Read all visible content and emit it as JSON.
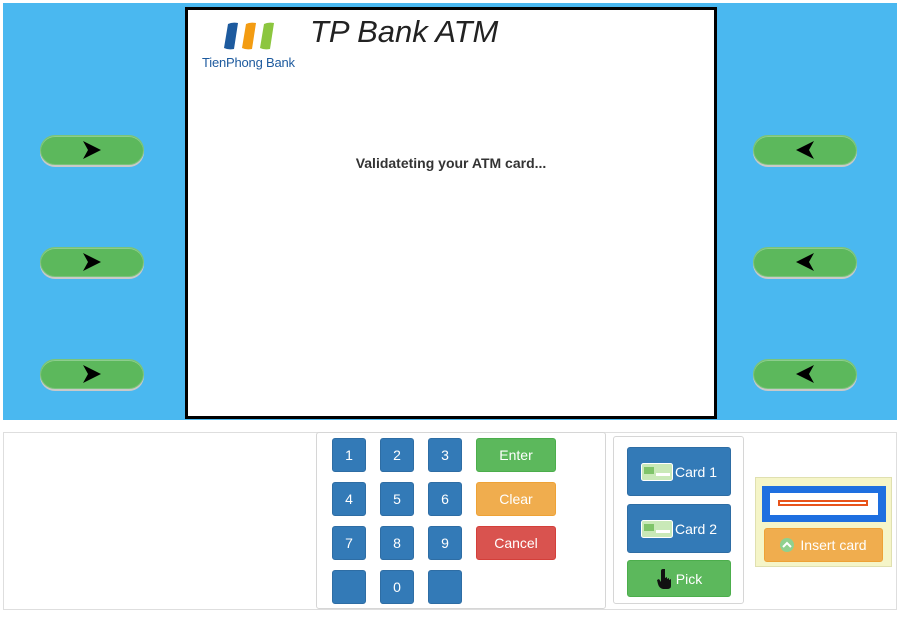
{
  "screen": {
    "bank_name": "TienPhong Bank",
    "title": "TP Bank ATM",
    "message": "Validateting your ATM card..."
  },
  "keypad": {
    "keys": [
      "1",
      "2",
      "3",
      "4",
      "5",
      "6",
      "7",
      "8",
      "9",
      "",
      "0",
      ""
    ],
    "enter_label": "Enter",
    "clear_label": "Clear",
    "cancel_label": "Cancel"
  },
  "cards": {
    "card1_label": "Card 1",
    "card2_label": "Card 2",
    "pick_label": "Pick"
  },
  "slot": {
    "insert_label": "Insert card"
  },
  "colors": {
    "panel_blue": "#4ab8f0",
    "primary": "#337ab7",
    "success": "#5cb85c",
    "warning": "#f0ad4e",
    "danger": "#d9534f",
    "logo_blue": "#1d5a9e",
    "logo_orange": "#f39c12",
    "logo_green": "#8cc63f"
  }
}
